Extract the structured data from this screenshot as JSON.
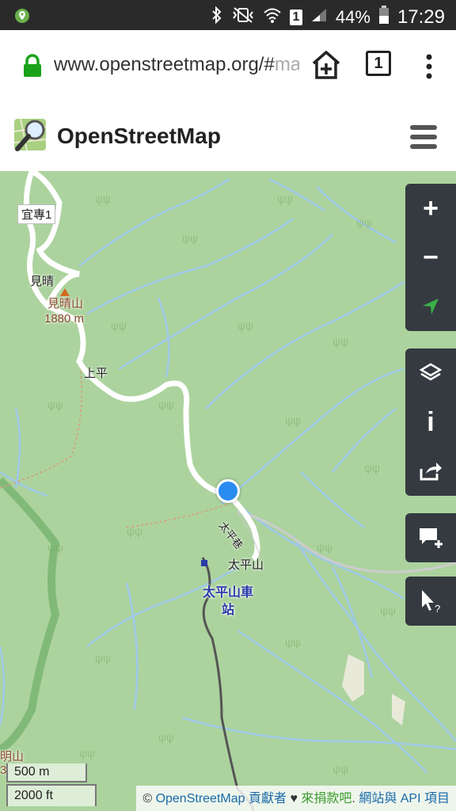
{
  "status_bar": {
    "battery": "44%",
    "time": "17:29",
    "sim_badge": "1"
  },
  "browser": {
    "url_main": "www.openstreetmap.org/#",
    "url_fade": "map",
    "tab_count": "1"
  },
  "header": {
    "title": "OpenStreetMap"
  },
  "map": {
    "labels": {
      "yizhuan": "宜專1",
      "jianqing": "見晴",
      "jianqingshan": "見晴山",
      "elev": "1880 m",
      "shangping": "上平",
      "taipingshan": "太平山",
      "station_line1": "太平山車",
      "station_line2": "站",
      "road": "太平巷",
      "edge1": "明山",
      "edge2": "3"
    },
    "scale": {
      "metric": "500 m",
      "imperial": "2000 ft"
    },
    "attribution": {
      "copy": "©",
      "osm": "OpenStreetMap",
      "contributors": "貢獻者",
      "heart": "♥",
      "donate": "來捐款吧",
      "dot": ".",
      "site_api": "網站與 API 項目"
    }
  },
  "controls": {
    "zoom_in": "+",
    "zoom_out": "−",
    "info": "i"
  }
}
